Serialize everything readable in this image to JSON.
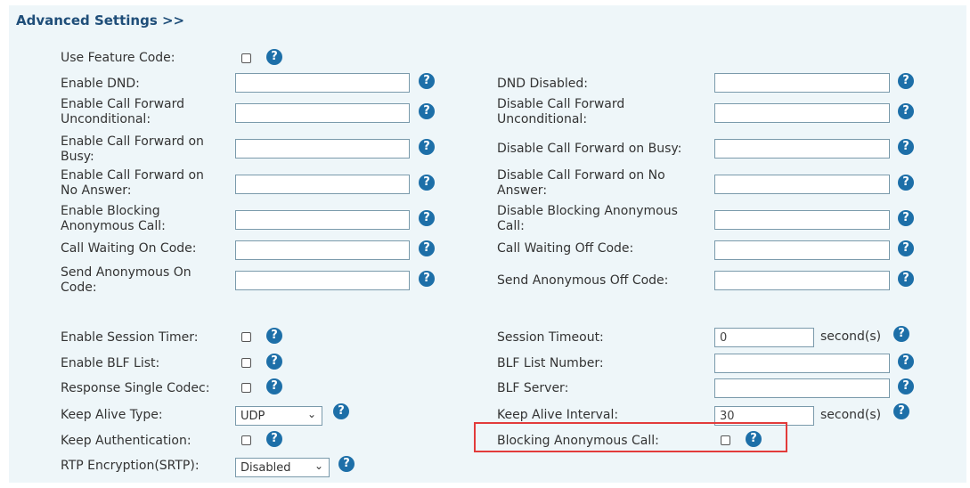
{
  "section_title": "Advanced Settings >>",
  "left": {
    "use_feature_code": "Use Feature Code:",
    "enable_dnd": "Enable DND:",
    "enable_cfu": "Enable Call Forward\nUnconditional:",
    "enable_cfb": "Enable Call Forward on\nBusy:",
    "enable_cfna": "Enable Call Forward on\nNo Answer:",
    "enable_block_anon": "Enable Blocking\nAnonymous Call:",
    "call_waiting_on": "Call Waiting On Code:",
    "send_anon_on": "Send Anonymous On\nCode:",
    "enable_session_timer": "Enable Session Timer:",
    "enable_blf_list": "Enable BLF List:",
    "response_single_codec": "Response Single Codec:",
    "keep_alive_type": "Keep Alive Type:",
    "keep_authentication": "Keep Authentication:",
    "rtp_encryption": "RTP Encryption(SRTP):"
  },
  "right": {
    "dnd_disabled": "DND Disabled:",
    "disable_cfu": "Disable Call Forward\nUnconditional:",
    "disable_cfb": "Disable Call Forward on Busy:",
    "disable_cfna": "Disable Call Forward on No\nAnswer:",
    "disable_block_anon": "Disable Blocking Anonymous\nCall:",
    "call_waiting_off": "Call Waiting Off Code:",
    "send_anon_off": "Send Anonymous Off Code:",
    "session_timeout": "Session Timeout:",
    "blf_list_number": "BLF List Number:",
    "blf_server": "BLF Server:",
    "keep_alive_interval": "Keep Alive Interval:",
    "blocking_anon_call": "Blocking Anonymous Call:"
  },
  "values": {
    "session_timeout": "0",
    "keep_alive_interval": "30",
    "keep_alive_type": "UDP",
    "rtp_encryption": "Disabled"
  },
  "unit_seconds": "second(s)",
  "help_glyph": "?",
  "select_arrow": "⌄",
  "colors": {
    "panel": "#eef6f9",
    "help": "#1d6fa8",
    "highlight": "#e23b3b",
    "title": "#1f4e79"
  }
}
